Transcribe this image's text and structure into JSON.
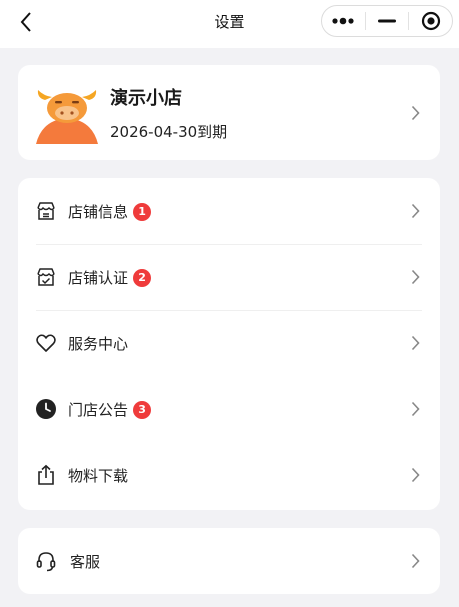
{
  "nav": {
    "title": "设置",
    "capsule": [
      "more-icon",
      "minimize-icon",
      "close-circle-icon"
    ]
  },
  "store": {
    "name": "演示小店",
    "expiry": "2026-04-30到期"
  },
  "menu": [
    {
      "label": "店铺信息",
      "badge": "1",
      "icon": "store-info-icon"
    },
    {
      "label": "店铺认证",
      "badge": "2",
      "icon": "store-auth-icon"
    },
    {
      "label": "服务中心",
      "badge": "",
      "icon": "heart-icon"
    },
    {
      "label": "门店公告",
      "badge": "3",
      "icon": "clock-icon"
    },
    {
      "label": "物料下载",
      "badge": "",
      "icon": "share-upload-icon"
    }
  ],
  "service": {
    "label": "客服",
    "icon": "headset-icon"
  },
  "colors": {
    "badge": "#ef3b3b",
    "background": "#f2f2f5",
    "mascot": "#f39a3c"
  }
}
